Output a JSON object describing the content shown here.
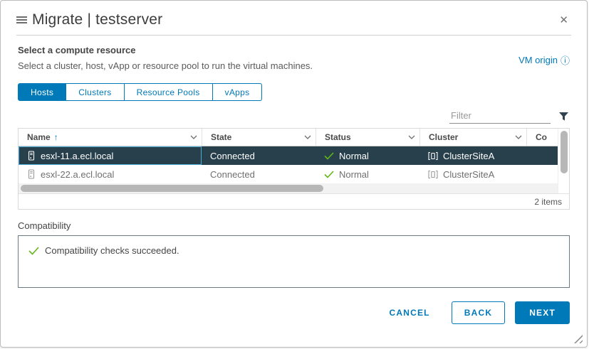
{
  "colors": {
    "accent": "#0079b8",
    "selected_row_bg": "#28404c",
    "focus_cell_border": "#49afd9",
    "success_green": "#61b715",
    "filter_icon": "#30414f"
  },
  "header": {
    "title": "Migrate | testserver",
    "close_glyph": "✕"
  },
  "intro": {
    "heading": "Select a compute resource",
    "subheading": "Select a cluster, host, vApp or resource pool to run the virtual machines.",
    "vm_origin_label": "VM origin",
    "info_glyph": "ⓘ"
  },
  "tabs": [
    {
      "label": "Hosts",
      "active": true
    },
    {
      "label": "Clusters",
      "active": false
    },
    {
      "label": "Resource Pools",
      "active": false
    },
    {
      "label": "vApps",
      "active": false
    }
  ],
  "filter": {
    "placeholder": "Filter"
  },
  "table": {
    "columns": [
      "Name",
      "State",
      "Status",
      "Cluster",
      "Co"
    ],
    "sort_glyph": "↑",
    "rows": [
      {
        "name": "esxl-11.a.ecl.local",
        "state": "Connected",
        "status": "Normal",
        "cluster": "ClusterSiteA",
        "selected": true
      },
      {
        "name": "esxl-22.a.ecl.local",
        "state": "Connected",
        "status": "Normal",
        "cluster": "ClusterSiteA",
        "selected": false
      }
    ],
    "footer": "2 items"
  },
  "compatibility": {
    "label": "Compatibility",
    "message": "Compatibility checks succeeded."
  },
  "actions": {
    "cancel": "CANCEL",
    "back": "BACK",
    "next": "NEXT"
  }
}
